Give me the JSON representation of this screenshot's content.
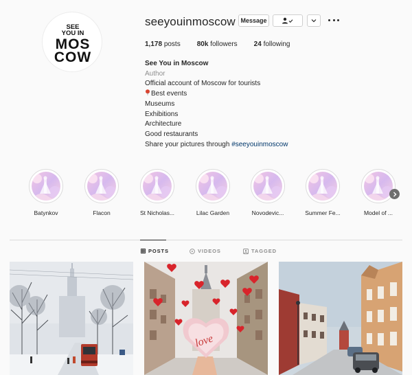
{
  "profile": {
    "username": "seeyouinmoscow",
    "logo_text": [
      "SEE",
      "YOU IN",
      "MOS",
      "COW"
    ],
    "buttons": {
      "message": "Message"
    }
  },
  "stats": {
    "posts_count": "1,178",
    "posts_label": "posts",
    "followers_count": "80k",
    "followers_label": "followers",
    "following_count": "24",
    "following_label": "following"
  },
  "bio": {
    "name": "See You in Moscow",
    "category": "Author",
    "line1": "Official account of Moscow for tourists",
    "line2": "Best events",
    "line3": "Museums",
    "line4": "Exhibitions",
    "line5": "Architecture",
    "line6": "Good restaurants",
    "line7_prefix": "Share your pictures through ",
    "hashtag": "#seeyouinmoscow"
  },
  "highlights": [
    {
      "label": "Batynkov"
    },
    {
      "label": "Flacon"
    },
    {
      "label": "St Nicholas..."
    },
    {
      "label": "Lilac Garden"
    },
    {
      "label": "Novodevic..."
    },
    {
      "label": "Summer Fe..."
    },
    {
      "label": "Model of ..."
    }
  ],
  "tabs": {
    "posts": "POSTS",
    "videos": "VIDEOS",
    "tagged": "TAGGED"
  },
  "colors": {
    "link": "#00376b",
    "secondary_text": "#8e8e8e",
    "border": "#dbdbdb"
  },
  "icons": [
    "follow-person-icon",
    "chevron-down-icon",
    "more-options-icon",
    "pin-icon",
    "chevron-right-icon",
    "grid-icon",
    "video-icon",
    "tagged-icon"
  ]
}
